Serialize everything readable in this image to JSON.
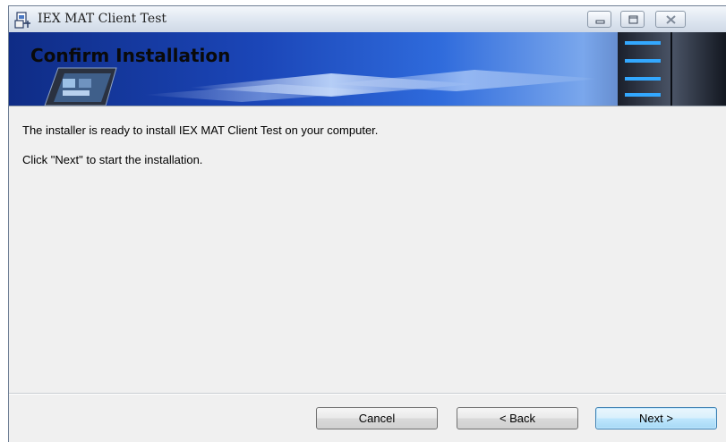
{
  "window": {
    "title": "IEX MAT Client Test"
  },
  "banner": {
    "title": "Confirm Installation"
  },
  "content": {
    "line1": "The installer is ready to install IEX MAT Client Test on your computer.",
    "line2": "Click \"Next\" to start the installation."
  },
  "buttons": {
    "cancel": "Cancel",
    "back": "< Back",
    "next": "Next >"
  },
  "icons": {
    "app": "installer-icon",
    "minimize": "minimize-icon",
    "maximize": "maximize-icon",
    "close": "close-icon"
  },
  "colors": {
    "banner_dark": "#0f2c86",
    "banner_light": "#7aa7ec",
    "next_button": "#bee6fd"
  }
}
